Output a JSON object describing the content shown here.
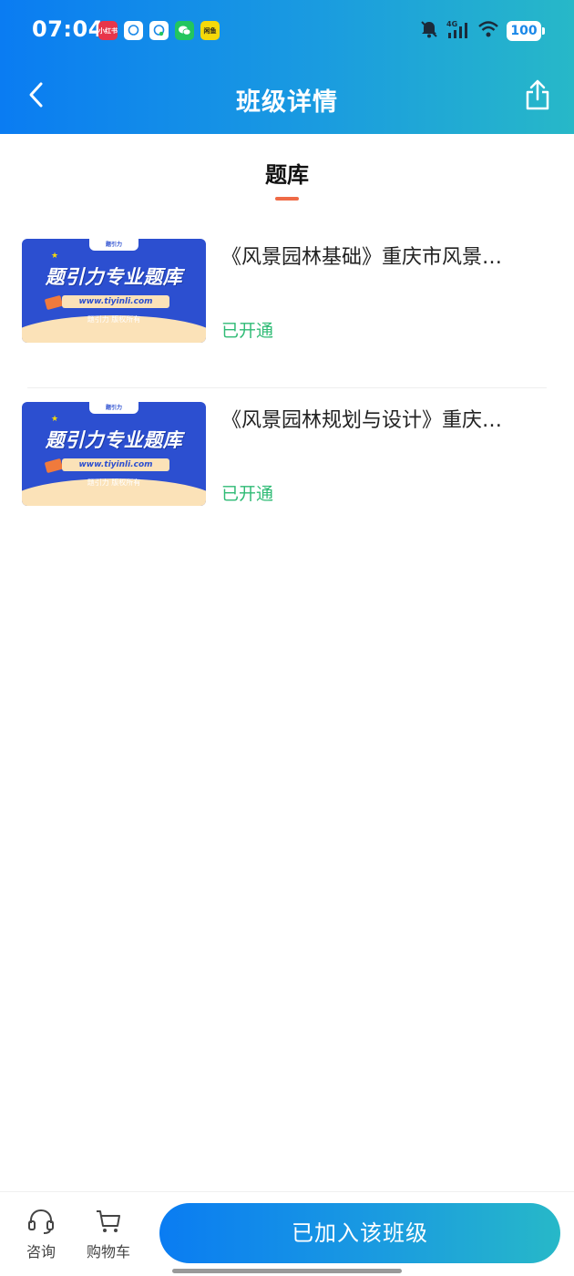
{
  "status_bar": {
    "time": "07:04",
    "app_icons": [
      "小红书",
      "",
      "",
      "",
      "闲鱼"
    ],
    "network": "4G",
    "battery": "100"
  },
  "nav": {
    "title": "班级详情",
    "back_icon": "chevron-left-icon",
    "share_icon": "share-icon"
  },
  "section": {
    "title": "题库",
    "accent_color": "#ef6a46"
  },
  "items": [
    {
      "title": "《风景园林基础》重庆市风景…",
      "status": "已开通",
      "thumbnail": {
        "logo": "题引力",
        "heading": "题引力专业题库",
        "url": "www.tiyinli.com",
        "copyright": "题引力 版权所有"
      }
    },
    {
      "title": "《风景园林规划与设计》重庆…",
      "status": "已开通",
      "thumbnail": {
        "logo": "题引力",
        "heading": "题引力专业题库",
        "url": "www.tiyinli.com",
        "copyright": "题引力 版权所有"
      }
    }
  ],
  "bottom_bar": {
    "consult_label": "咨询",
    "consult_icon": "headset-icon",
    "cart_label": "购物车",
    "cart_icon": "cart-icon",
    "joined_label": "已加入该班级"
  },
  "colors": {
    "primary_start": "#0a7cf2",
    "primary_end": "#27b8c8",
    "status_green": "#2fbb75"
  }
}
